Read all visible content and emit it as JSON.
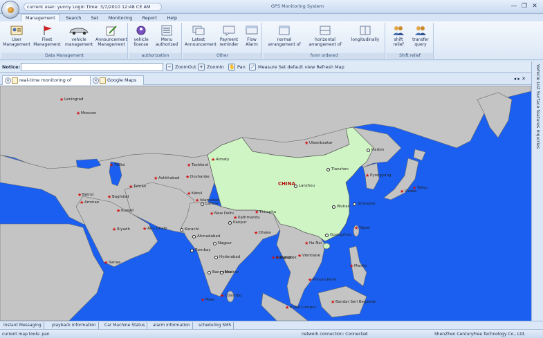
{
  "titlebar": {
    "user_info": "current user: yunny Login Time: 3/7/2010 12:48 CE AM",
    "app_title": "GPS Monitoring System",
    "minimize": "—",
    "restore": "❐",
    "close": "✕"
  },
  "menu": {
    "tabs": [
      "Management",
      "Search",
      "Set",
      "Monitoring",
      "Report",
      "Help"
    ],
    "active": "Management"
  },
  "ribbon": {
    "groups": [
      {
        "title": "Data Management",
        "buttons": [
          "User Management",
          "Fleet Management",
          "vehicle management",
          "Announcement Management"
        ]
      },
      {
        "title": "authorization",
        "buttons": [
          "vehicle license",
          "Menu authorized"
        ]
      },
      {
        "title": "Other",
        "buttons": [
          "Latest Announcement",
          "Payment reminder",
          "Flow Alarm"
        ]
      },
      {
        "title": "form ordered",
        "buttons": [
          "normal arrangement of",
          "horizontal arrangement of",
          "longitudinally"
        ]
      },
      {
        "title": "Shift relief",
        "buttons": [
          "shift relief",
          "transfer query"
        ]
      }
    ]
  },
  "toolbar": {
    "notice_label": "Notice:",
    "notice_value": "",
    "zoom_out": "ZoomOut",
    "zoom_in": "ZoomIn",
    "pan": "Pan",
    "measure": "Measure Set default view Refresh Map"
  },
  "doc_tabs": {
    "tab1": "real-time monitoring of vehicles",
    "tab2": "Google Maps",
    "nav": "◂ ▸ ✕"
  },
  "right_panel": {
    "label": "Vehicle List Surface features Inquiries"
  },
  "map": {
    "country_label": "CHINA",
    "cities": [
      {
        "name": "Leningrad",
        "t": "star"
      },
      {
        "name": "Moscow",
        "t": "star"
      },
      {
        "name": "Ulaanbaatar",
        "t": "star"
      },
      {
        "name": "Harbin",
        "t": "dot"
      },
      {
        "name": "Tianzhen",
        "t": "dot"
      },
      {
        "name": "Tokyo",
        "t": "star"
      },
      {
        "name": "Osaka",
        "t": "star"
      },
      {
        "name": "Pyongyang",
        "t": "star"
      },
      {
        "name": "Lanzhou",
        "t": "dot"
      },
      {
        "name": "Wuhan",
        "t": "dot"
      },
      {
        "name": "Shanghai",
        "t": "dot"
      },
      {
        "name": "Taipei",
        "t": "star"
      },
      {
        "name": "Guangzhou",
        "t": "dot"
      },
      {
        "name": "Ha Noi",
        "t": "star"
      },
      {
        "name": "Vientiane",
        "t": "star"
      },
      {
        "name": "Bangkok",
        "t": "star"
      },
      {
        "name": "Phnom Penh",
        "t": "star"
      },
      {
        "name": "Manila",
        "t": "star"
      },
      {
        "name": "Kuala Lumpur",
        "t": "star"
      },
      {
        "name": "Bandar Seri Begawan",
        "t": "star"
      },
      {
        "name": "Tbilisi",
        "t": "star"
      },
      {
        "name": "Tashkent",
        "t": "star"
      },
      {
        "name": "Almaty",
        "t": "star"
      },
      {
        "name": "Ashkhabad",
        "t": "star"
      },
      {
        "name": "Dushanbe",
        "t": "star"
      },
      {
        "name": "Tehran",
        "t": "star"
      },
      {
        "name": "Baghdad",
        "t": "star"
      },
      {
        "name": "Beirut",
        "t": "star"
      },
      {
        "name": "Amman",
        "t": "star"
      },
      {
        "name": "Kuwait",
        "t": "star"
      },
      {
        "name": "Riyadh",
        "t": "star"
      },
      {
        "name": "Abu Dhabi",
        "t": "star"
      },
      {
        "name": "Sanaa",
        "t": "star"
      },
      {
        "name": "Kabul",
        "t": "star"
      },
      {
        "name": "Islamabad",
        "t": "star"
      },
      {
        "name": "Lahore",
        "t": "dot"
      },
      {
        "name": "Karachi",
        "t": "dot"
      },
      {
        "name": "New Delhi",
        "t": "star"
      },
      {
        "name": "Kathmandu",
        "t": "star"
      },
      {
        "name": "Thimphu",
        "t": "star"
      },
      {
        "name": "Kanpur",
        "t": "dot"
      },
      {
        "name": "Ahmadabad",
        "t": "dot"
      },
      {
        "name": "Nagpur",
        "t": "dot"
      },
      {
        "name": "Bombay",
        "t": "dot"
      },
      {
        "name": "Hyderabad",
        "t": "dot"
      },
      {
        "name": "Bangalore",
        "t": "dot"
      },
      {
        "name": "Madras",
        "t": "dot"
      },
      {
        "name": "Colombo",
        "t": "star"
      },
      {
        "name": "Male",
        "t": "star"
      },
      {
        "name": "Dhaka",
        "t": "star"
      },
      {
        "name": "Rangoon",
        "t": "star"
      }
    ]
  },
  "bottom_tabs": [
    "Instant Messaging",
    "playback information",
    "Car Machine Status",
    "alarm information",
    "scheduling SMS"
  ],
  "status": {
    "tool": "current map tools: pan",
    "network": "network connection: Connected",
    "company": "ShenZhen CenturyFree Technology Co., Ltd."
  }
}
